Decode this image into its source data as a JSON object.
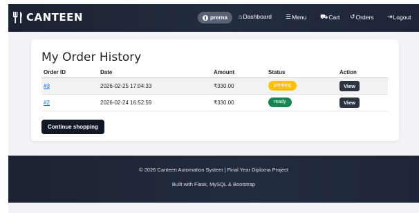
{
  "brand": {
    "name": "CANTEEN",
    "icon": "fork-knife-icon"
  },
  "navbar": {
    "user": "prerna",
    "links": [
      {
        "label": "Dashboard",
        "icon": "home-icon"
      },
      {
        "label": "Menu",
        "icon": "list-icon"
      },
      {
        "label": "Cart",
        "icon": "cart-icon"
      },
      {
        "label": "Orders",
        "icon": "history-icon"
      },
      {
        "label": "Logout",
        "icon": "logout-icon"
      }
    ]
  },
  "orders": {
    "title": "My Order History",
    "columns": [
      "Order ID",
      "Date",
      "Amount",
      "Status",
      "Action"
    ],
    "rows": [
      {
        "id": "#3",
        "date": "2026-02-25 17:04:33",
        "amount": "₹330.00",
        "status": "pending",
        "action": "View"
      },
      {
        "id": "#2",
        "date": "2026-02-24 16:52:59",
        "amount": "₹330.00",
        "status": "ready",
        "action": "View"
      }
    ],
    "continue_label": "Continue shopping"
  },
  "footer": {
    "line1": "© 2026 Canteen Automation System | Final Year Diploma Project",
    "line2": "Built with Flask, MySQL & Bootstrap"
  },
  "colors": {
    "pending": "#ffc107",
    "ready": "#198754",
    "nav_bg": "#1f2638"
  }
}
